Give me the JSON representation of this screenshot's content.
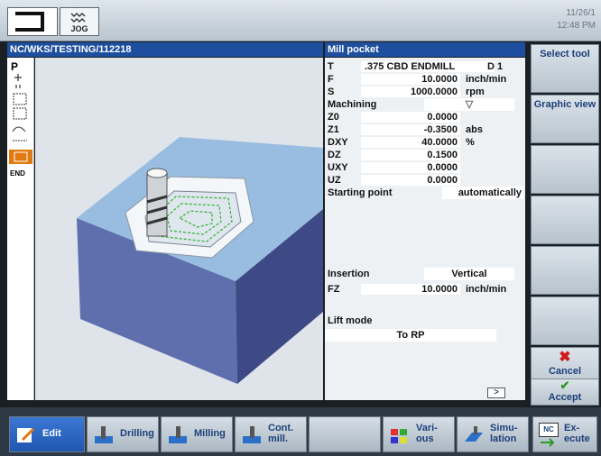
{
  "top": {
    "jog_label": "JOG",
    "date": "11/26/1",
    "time": "12:48 PM"
  },
  "left_title": "NC/WKS/TESTING/112218",
  "strip_items": [
    "P",
    "END"
  ],
  "panel_title": "Mill pocket",
  "params": [
    {
      "label": "T",
      "value": ".375 CBD ENDMILL",
      "unit": "D 1"
    },
    {
      "label": "F",
      "value": "10.0000",
      "unit": "inch/min"
    },
    {
      "label": "S",
      "value": "1000.0000",
      "unit": "rpm"
    },
    {
      "label": "Machining",
      "value": "",
      "unit": "",
      "dropdown": "▽"
    },
    {
      "label": "Z0",
      "value": "0.0000",
      "unit": ""
    },
    {
      "label": "Z1",
      "value": "-0.3500",
      "unit": "abs"
    },
    {
      "label": "DXY",
      "value": "40.0000",
      "unit": "%"
    },
    {
      "label": "DZ",
      "value": "0.1500",
      "unit": ""
    },
    {
      "label": "UXY",
      "value": "0.0000",
      "unit": ""
    },
    {
      "label": "UZ",
      "value": "0.0000",
      "unit": ""
    }
  ],
  "starting_point": {
    "label": "Starting point",
    "value": "automatically"
  },
  "insertion": {
    "label": "Insertion",
    "value": "Vertical"
  },
  "fz": {
    "label": "FZ",
    "value": "10.0000",
    "unit": "inch/min"
  },
  "lift_mode": {
    "label": "Lift mode",
    "value": "To RP"
  },
  "softkeys": {
    "select_tool": "Select tool",
    "graphic_view": "Graphic view",
    "cancel": "Cancel",
    "accept": "Accept"
  },
  "scroll_arrow": ">",
  "bottom": {
    "edit": "Edit",
    "drilling": "Drilling",
    "milling": "Milling",
    "cont_mill_1": "Cont.",
    "cont_mill_2": "mill.",
    "various_1": "Vari-",
    "various_2": "ous",
    "simulation_1": "Simu-",
    "simulation_2": "lation",
    "execute_1": "Ex-",
    "execute_2": "ecute",
    "nc_badge": "NC"
  },
  "colors": {
    "title_blue": "#1d4f9e",
    "selection_orange": "#e07a10",
    "cancel_red": "#d11a1a",
    "accept_green": "#2a9a2a"
  }
}
